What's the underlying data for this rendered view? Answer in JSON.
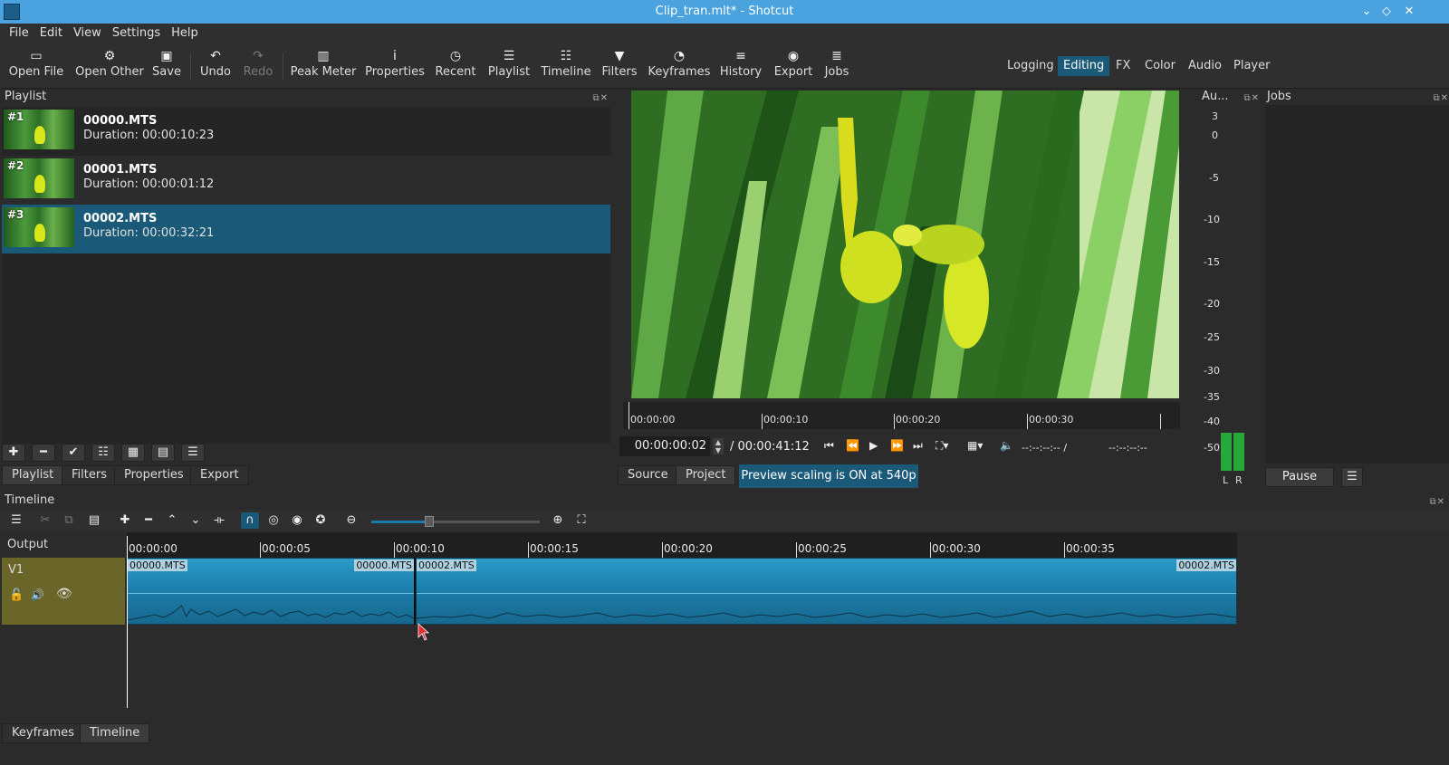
{
  "window": {
    "title": "Clip_tran.mlt* - Shotcut",
    "minimize": "⌄",
    "maximize": "◇",
    "close": "✕"
  },
  "menu": [
    "File",
    "Edit",
    "View",
    "Settings",
    "Help"
  ],
  "toolbar": {
    "open_file": "Open File",
    "open_other": "Open Other",
    "save": "Save",
    "undo": "Undo",
    "redo": "Redo",
    "peak_meter": "Peak Meter",
    "properties": "Properties",
    "recent": "Recent",
    "playlist": "Playlist",
    "timeline": "Timeline",
    "filters": "Filters",
    "keyframes": "Keyframes",
    "history": "History",
    "export": "Export",
    "jobs": "Jobs"
  },
  "layouts": {
    "logging": "Logging",
    "editing": "Editing",
    "fx": "FX",
    "color": "Color",
    "audio": "Audio",
    "player": "Player",
    "active": "Editing"
  },
  "playlist": {
    "title": "Playlist",
    "items": [
      {
        "num": "#1",
        "name": "00000.MTS",
        "duration": "Duration: 00:00:10:23"
      },
      {
        "num": "#2",
        "name": "00001.MTS",
        "duration": "Duration: 00:00:01:12"
      },
      {
        "num": "#3",
        "name": "00002.MTS",
        "duration": "Duration: 00:00:32:21",
        "selected": true
      }
    ],
    "tabs": {
      "playlist": "Playlist",
      "filters": "Filters",
      "properties": "Properties",
      "export": "Export"
    }
  },
  "viewer": {
    "ruler": [
      "00:00:00",
      "00:00:10",
      "00:00:20",
      "00:00:30"
    ],
    "current_time": "00:00:00:02",
    "total_time": "/ 00:00:41:12",
    "in_point": "--:--:--:-- /",
    "out_point": "--:--:--:--",
    "tabs": {
      "source": "Source",
      "project": "Project"
    },
    "preview_scaling": "Preview scaling is ON at 540p"
  },
  "audio_meter": {
    "title": "Au...",
    "levels": [
      "3",
      "0",
      "-5",
      "-10",
      "-15",
      "-20",
      "-25",
      "-30",
      "-35",
      "-40",
      "-50"
    ],
    "left": "L",
    "right": "R"
  },
  "jobs": {
    "title": "Jobs",
    "pause": "Pause",
    "menu": "☰"
  },
  "timeline": {
    "title": "Timeline",
    "output": "Output",
    "track": "V1",
    "ruler": [
      "00:00:00",
      "00:00:05",
      "00:00:10",
      "00:00:15",
      "00:00:20",
      "00:00:25",
      "00:00:30",
      "00:00:35"
    ],
    "clips": [
      {
        "start_label": "00000.MTS",
        "end_label": "00000.MTS"
      },
      {
        "start_label": "00002.MTS",
        "end_label": "00002.MTS"
      }
    ]
  },
  "bottom_tabs": {
    "keyframes": "Keyframes",
    "timeline": "Timeline"
  },
  "colors": {
    "accent": "#1a5a78",
    "titlebar": "#4aa3df",
    "clip": "#1b7aa5",
    "track_header": "#6a6528"
  }
}
